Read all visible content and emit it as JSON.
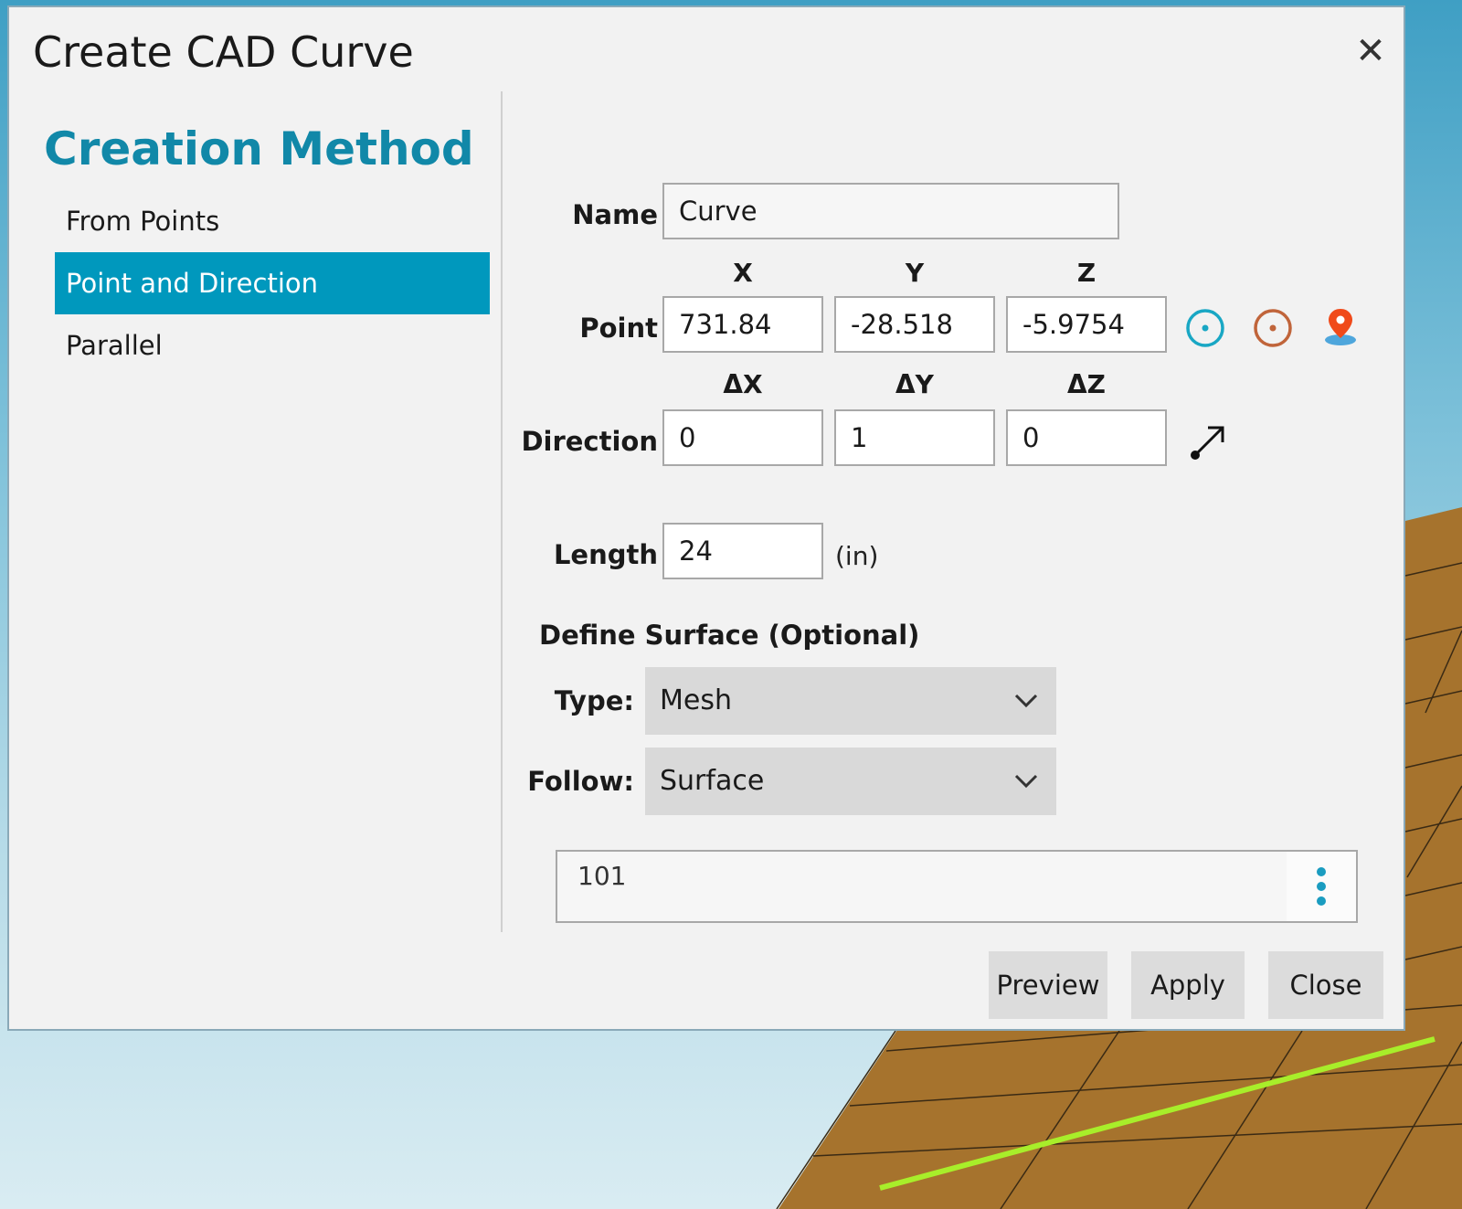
{
  "dialog": {
    "title": "Create CAD Curve",
    "close_glyph": "✕"
  },
  "creation_method": {
    "heading": "Creation Method",
    "items": [
      {
        "label": "From Points",
        "selected": false
      },
      {
        "label": "Point and Direction",
        "selected": true
      },
      {
        "label": "Parallel",
        "selected": false
      }
    ]
  },
  "form": {
    "name_label": "Name",
    "name_value": "Curve",
    "point": {
      "label": "Point",
      "headers": [
        "X",
        "Y",
        "Z"
      ],
      "values": [
        "731.84",
        "-28.518",
        "-5.9754"
      ]
    },
    "direction": {
      "label": "Direction",
      "headers": [
        "ΔX",
        "ΔY",
        "ΔZ"
      ],
      "values": [
        "0",
        "1",
        "0"
      ]
    },
    "length": {
      "label": "Length",
      "value": "24",
      "unit": "(in)"
    },
    "surface": {
      "heading": "Define Surface (Optional)",
      "type_label": "Type:",
      "type_value": "Mesh",
      "follow_label": "Follow:",
      "follow_value": "Surface",
      "selection_value": "101"
    }
  },
  "buttons": {
    "preview": "Preview",
    "apply": "Apply",
    "close": "Close"
  },
  "icons": {
    "pick_point": "target-circle-icon",
    "pick_center": "center-point-icon",
    "pick_location": "map-pin-icon",
    "pick_direction": "direction-arrow-icon",
    "more": "kebab-menu-icon",
    "dropdown": "chevron-down-icon"
  },
  "colors": {
    "accent": "#0098bd",
    "heading": "#1188a8",
    "mesh": "#a6732d",
    "curve": "#a8ee2a"
  }
}
